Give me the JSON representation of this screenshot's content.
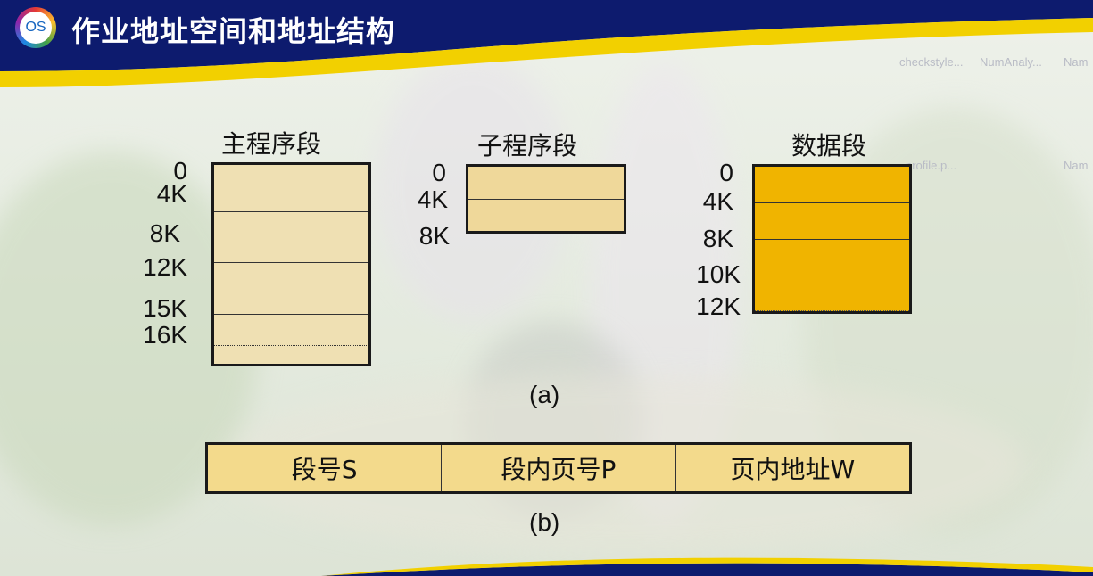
{
  "header": {
    "logo_text": "OS",
    "title": "作业地址空间和地址结构"
  },
  "desktop_icons": [
    "checkstyle...",
    "NumAnaly...",
    "Nam",
    "profile.p...",
    "Nam"
  ],
  "diagram_a": {
    "segments": [
      {
        "title": "主程序段",
        "addresses": [
          "0",
          "4K",
          "8K",
          "12K",
          "15K",
          "16K"
        ],
        "fill": "#efe0b3"
      },
      {
        "title": "子程序段",
        "addresses": [
          "0",
          "4K",
          "8K"
        ],
        "fill": "#efd89a"
      },
      {
        "title": "数据段",
        "addresses": [
          "0",
          "4K",
          "8K",
          "10K",
          "12K"
        ],
        "fill": "#f0b400"
      }
    ],
    "caption": "(a)"
  },
  "diagram_b": {
    "fields": [
      "段号S",
      "段内页号P",
      "页内地址W"
    ],
    "caption": "(b)"
  },
  "colors": {
    "header_bg": "#0d1b6e",
    "accent_yellow": "#f2d000"
  }
}
